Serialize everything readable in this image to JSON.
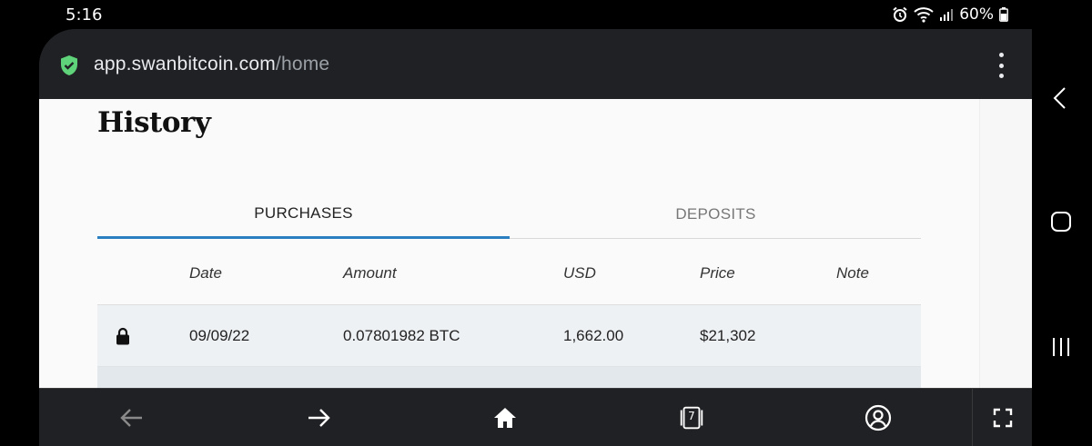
{
  "status_bar": {
    "time": "5:16",
    "battery": "60%"
  },
  "browser": {
    "url_host": "app.swanbitcoin.com",
    "url_path": "/home",
    "tab_count": "7"
  },
  "page": {
    "title": "History",
    "tabs": [
      {
        "label": "PURCHASES",
        "active": true
      },
      {
        "label": "DEPOSITS",
        "active": false
      }
    ],
    "columns": [
      "Date",
      "Amount",
      "USD",
      "Price",
      "Note"
    ],
    "rows": [
      {
        "date": "09/09/22",
        "amount": "0.07801982 BTC",
        "usd": "1,662.00",
        "price": "$21,302",
        "note": ""
      }
    ]
  },
  "colors": {
    "accent_tab": "#2a7fc1",
    "secure_badge": "#5fd37a",
    "chrome_bg": "#202124"
  },
  "icons": {
    "secure": "shield-check-icon",
    "menu": "more-vert-icon",
    "row_lock": "padlock-icon",
    "back": "arrow-left-icon",
    "forward": "arrow-right-icon",
    "home": "home-icon",
    "tabs": "tabs-icon",
    "account": "account-icon",
    "fullscreen": "fullscreen-icon"
  }
}
